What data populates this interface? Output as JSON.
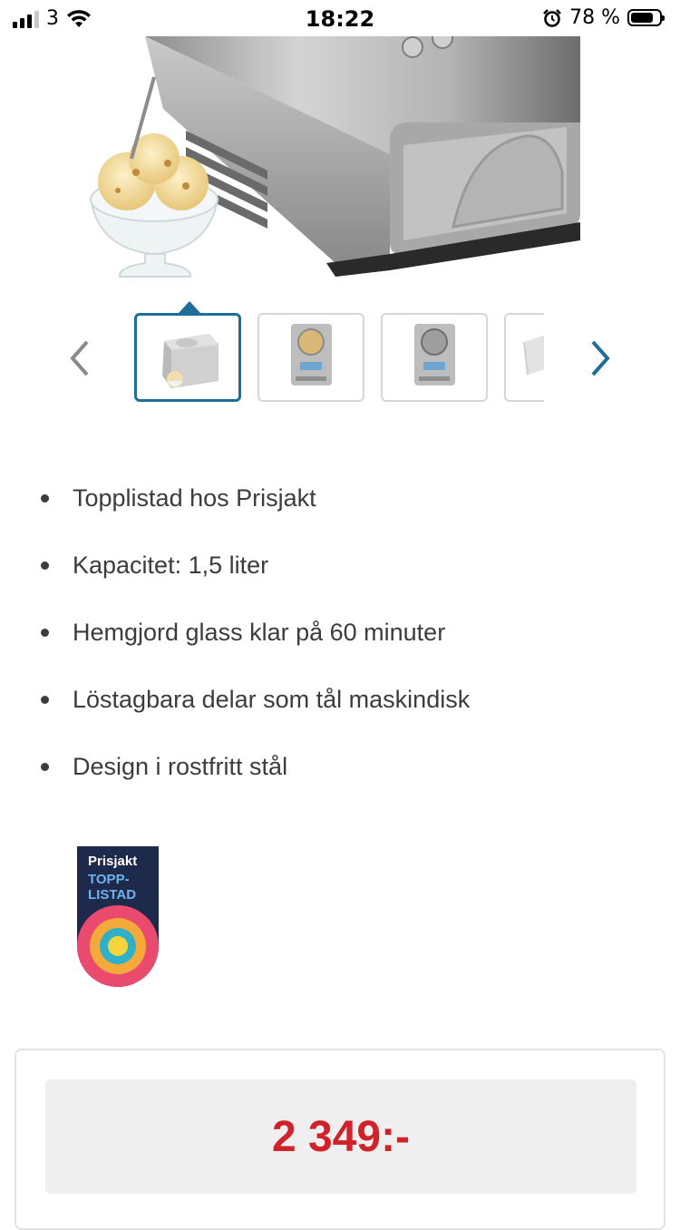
{
  "status_bar": {
    "carrier": "3",
    "time": "18:22",
    "battery": "78 %"
  },
  "gallery": {
    "thumbnails": [
      "ice-cream-machine-front",
      "machine-front-open",
      "machine-front-closed",
      "machine-partial"
    ],
    "active_index": 0
  },
  "features": [
    "Topplistad hos Prisjakt",
    "Kapacitet: 1,5 liter",
    "Hemgjord glass klar på 60 minuter",
    "Löstagbara delar som tål maskindisk",
    "Design i rostfritt stål"
  ],
  "badge": {
    "brand": "Prisjakt",
    "line1": "TOPP-",
    "line2": "LISTAD"
  },
  "price": {
    "value": "2 349:-",
    "color": "#d0222b"
  },
  "colors": {
    "accent": "#1f6e98"
  }
}
